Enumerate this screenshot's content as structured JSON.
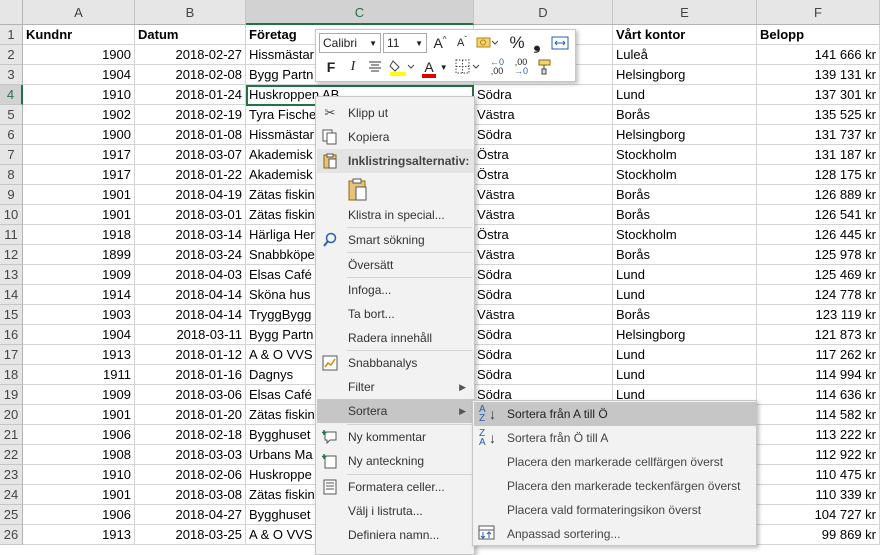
{
  "columns": [
    "A",
    "B",
    "C",
    "D",
    "E",
    "F"
  ],
  "selected_column": "C",
  "selected_row": "4",
  "headers": {
    "A": "Kundnr",
    "B": "Datum",
    "C": "Företag",
    "E": "Vårt kontor",
    "F": "Belopp"
  },
  "rows": [
    {
      "n": "2",
      "a": "1900",
      "b": "2018-02-27",
      "c": "Hissmästar",
      "d": "",
      "e": "Luleå",
      "f": "141 666 kr"
    },
    {
      "n": "3",
      "a": "1904",
      "b": "2018-02-08",
      "c": "Bygg Partn",
      "d": "",
      "e": "Helsingborg",
      "f": "139 131 kr"
    },
    {
      "n": "4",
      "a": "1910",
      "b": "2018-01-24",
      "c": "Huskroppen AB",
      "d": "Södra",
      "e": "Lund",
      "f": "137 301 kr"
    },
    {
      "n": "5",
      "a": "1902",
      "b": "2018-02-19",
      "c": "Tyra Fische",
      "d": "Västra",
      "e": "Borås",
      "f": "135 525 kr"
    },
    {
      "n": "6",
      "a": "1900",
      "b": "2018-01-08",
      "c": "Hissmästar",
      "d": "Södra",
      "e": "Helsingborg",
      "f": "131 737 kr"
    },
    {
      "n": "7",
      "a": "1917",
      "b": "2018-03-07",
      "c": "Akademisk",
      "d": "Östra",
      "e": "Stockholm",
      "f": "131 187 kr"
    },
    {
      "n": "8",
      "a": "1917",
      "b": "2018-01-22",
      "c": "Akademisk",
      "d": "Östra",
      "e": "Stockholm",
      "f": "128 175 kr"
    },
    {
      "n": "9",
      "a": "1901",
      "b": "2018-04-19",
      "c": "Zätas fiskin",
      "d": "Västra",
      "e": "Borås",
      "f": "126 889 kr"
    },
    {
      "n": "10",
      "a": "1901",
      "b": "2018-03-01",
      "c": "Zätas fiskin",
      "d": "Västra",
      "e": "Borås",
      "f": "126 541 kr"
    },
    {
      "n": "11",
      "a": "1918",
      "b": "2018-03-14",
      "c": "Härliga Her",
      "d": "Östra",
      "e": "Stockholm",
      "f": "126 445 kr"
    },
    {
      "n": "12",
      "a": "1899",
      "b": "2018-03-24",
      "c": "Snabbköpe",
      "d": "Västra",
      "e": "Borås",
      "f": "125 978 kr"
    },
    {
      "n": "13",
      "a": "1909",
      "b": "2018-04-03",
      "c": "Elsas Café",
      "d": "Södra",
      "e": "Lund",
      "f": "125 469 kr"
    },
    {
      "n": "14",
      "a": "1914",
      "b": "2018-04-14",
      "c": "Sköna hus",
      "d": "Södra",
      "e": "Lund",
      "f": "124 778 kr"
    },
    {
      "n": "15",
      "a": "1903",
      "b": "2018-04-14",
      "c": "TryggBygg",
      "d": "Västra",
      "e": "Borås",
      "f": "123 119 kr"
    },
    {
      "n": "16",
      "a": "1904",
      "b": "2018-03-11",
      "c": "Bygg Partn",
      "d": "Södra",
      "e": "Helsingborg",
      "f": "121 873 kr"
    },
    {
      "n": "17",
      "a": "1913",
      "b": "2018-01-12",
      "c": "A & O VVS",
      "d": "Södra",
      "e": "Lund",
      "f": "117 262 kr"
    },
    {
      "n": "18",
      "a": "1911",
      "b": "2018-01-16",
      "c": "Dagnys",
      "d": "Södra",
      "e": "Lund",
      "f": "114 994 kr"
    },
    {
      "n": "19",
      "a": "1909",
      "b": "2018-03-06",
      "c": "Elsas Café",
      "d": "Södra",
      "e": "Lund",
      "f": "114 636 kr"
    },
    {
      "n": "20",
      "a": "1901",
      "b": "2018-01-20",
      "c": "Zätas fiskin",
      "d": "",
      "e": "",
      "f": "114 582 kr"
    },
    {
      "n": "21",
      "a": "1906",
      "b": "2018-02-18",
      "c": "Bygghuset",
      "d": "",
      "e": "",
      "f": "113 222 kr"
    },
    {
      "n": "22",
      "a": "1908",
      "b": "2018-03-03",
      "c": "Urbans Ma",
      "d": "",
      "e": "",
      "f": "112 922 kr"
    },
    {
      "n": "23",
      "a": "1910",
      "b": "2018-02-06",
      "c": "Huskroppe",
      "d": "",
      "e": "",
      "f": "110 475 kr"
    },
    {
      "n": "24",
      "a": "1901",
      "b": "2018-03-08",
      "c": "Zätas fiskin",
      "d": "",
      "e": "",
      "f": "110 339 kr"
    },
    {
      "n": "25",
      "a": "1906",
      "b": "2018-04-27",
      "c": "Bygghuset",
      "d": "",
      "e": "",
      "f": "104 727 kr"
    },
    {
      "n": "26",
      "a": "1913",
      "b": "2018-03-25",
      "c": "A & O VVS",
      "d": "",
      "e": "",
      "f": "99 869 kr"
    }
  ],
  "mini_toolbar": {
    "font": "Calibri",
    "size": "11",
    "grow": "A",
    "shrink": "A",
    "percent": "%",
    "comma": "❟",
    "bold": "F",
    "italic": "I",
    "font_color_letter": "A",
    "dec_left": ",00",
    "dec_right": ",00"
  },
  "context_menu": {
    "cut": "Klipp ut",
    "copy": "Kopiera",
    "paste_options": "Inklistringsalternativ:",
    "paste_special": "Klistra in special...",
    "smart_lookup": "Smart sökning",
    "translate": "Översätt",
    "insert": "Infoga...",
    "delete": "Ta bort...",
    "clear": "Radera innehåll",
    "quick_analysis": "Snabbanalys",
    "filter": "Filter",
    "sort": "Sortera",
    "new_comment": "Ny kommentar",
    "new_note": "Ny anteckning",
    "format_cells": "Formatera celler...",
    "pick_list": "Välj i listruta...",
    "define_name": "Definiera namn..."
  },
  "sort_submenu": {
    "a_to_z": "Sortera från A till Ö",
    "z_to_a": "Sortera från Ö till A",
    "cell_color": "Placera den markerade cellfärgen överst",
    "font_color": "Placera den markerade teckenfärgen överst",
    "format_icon": "Placera vald formateringsikon överst",
    "custom": "Anpassad sortering..."
  },
  "colors": {
    "accent": "#217346",
    "highlight": "#c6c6c6",
    "font_red": "#e00000",
    "fill_yellow": "#ffff00"
  }
}
